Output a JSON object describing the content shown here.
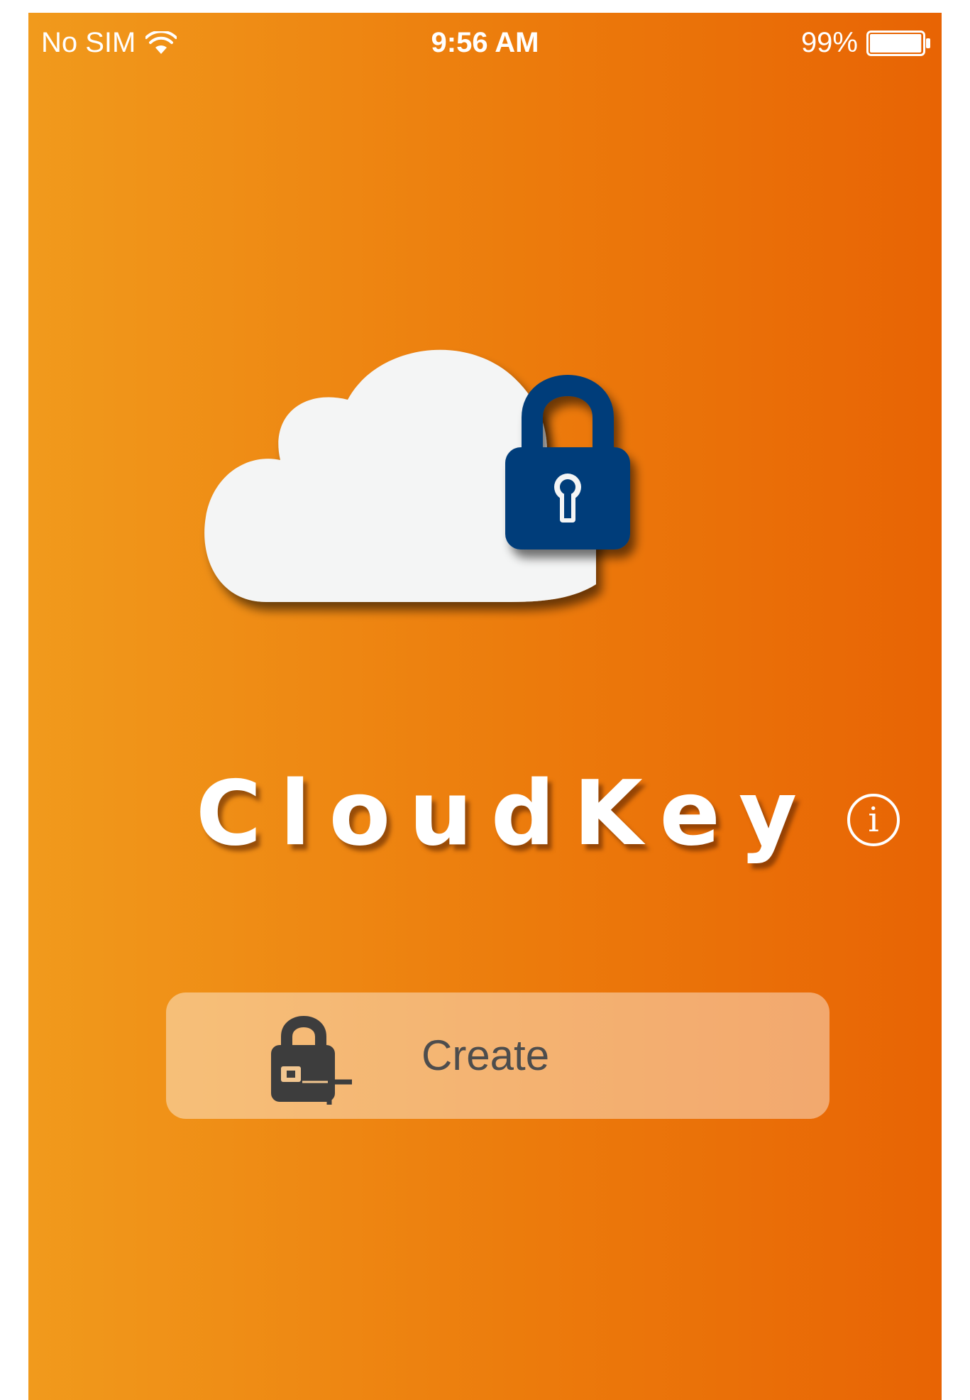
{
  "status_bar": {
    "carrier": "No SIM",
    "time": "9:56 AM",
    "battery_percent": "99%",
    "battery_level": 0.99,
    "wifi_icon": "wifi-icon",
    "battery_icon": "battery-icon"
  },
  "app": {
    "title": "CloudKey",
    "logo_icon": "cloud-lock-icon",
    "info_glyph": "i"
  },
  "actions": {
    "create_label": "Create",
    "create_icon": "lock-plus-icon"
  },
  "colors": {
    "gradient_start": "#f19a1c",
    "gradient_end": "#e86404",
    "cloud": "#f4f5f5",
    "lock": "#003d7a",
    "button_text": "#4d4d4d"
  }
}
